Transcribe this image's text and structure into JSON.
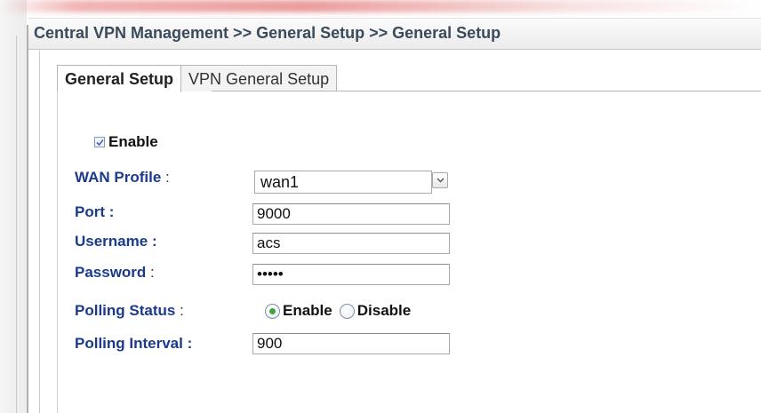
{
  "breadcrumb": "Central VPN Management >> General Setup >> General Setup",
  "tabs": [
    {
      "label": "General Setup",
      "active": true
    },
    {
      "label": "VPN General Setup",
      "active": false
    }
  ],
  "form": {
    "enable_label": "Enable",
    "enable_checked": true,
    "wan_profile": {
      "label": "WAN Profile",
      "colon": ":",
      "value": "wan1"
    },
    "port": {
      "label": "Port",
      "colon": ":",
      "value": "9000"
    },
    "username": {
      "label": "Username",
      "colon": ":",
      "value": "acs"
    },
    "password": {
      "label": "Password",
      "colon": ":",
      "value": "•••••"
    },
    "polling_status": {
      "label": "Polling Status",
      "colon": ":",
      "options": [
        {
          "label": "Enable",
          "selected": true
        },
        {
          "label": "Disable",
          "selected": false
        }
      ]
    },
    "polling_interval": {
      "label": "Polling Interval",
      "colon": ":",
      "value": "900"
    }
  },
  "colors": {
    "label_blue": "#1b3a8c",
    "title_text": "#3a4a5c",
    "radio_selected": "#3da63d"
  }
}
